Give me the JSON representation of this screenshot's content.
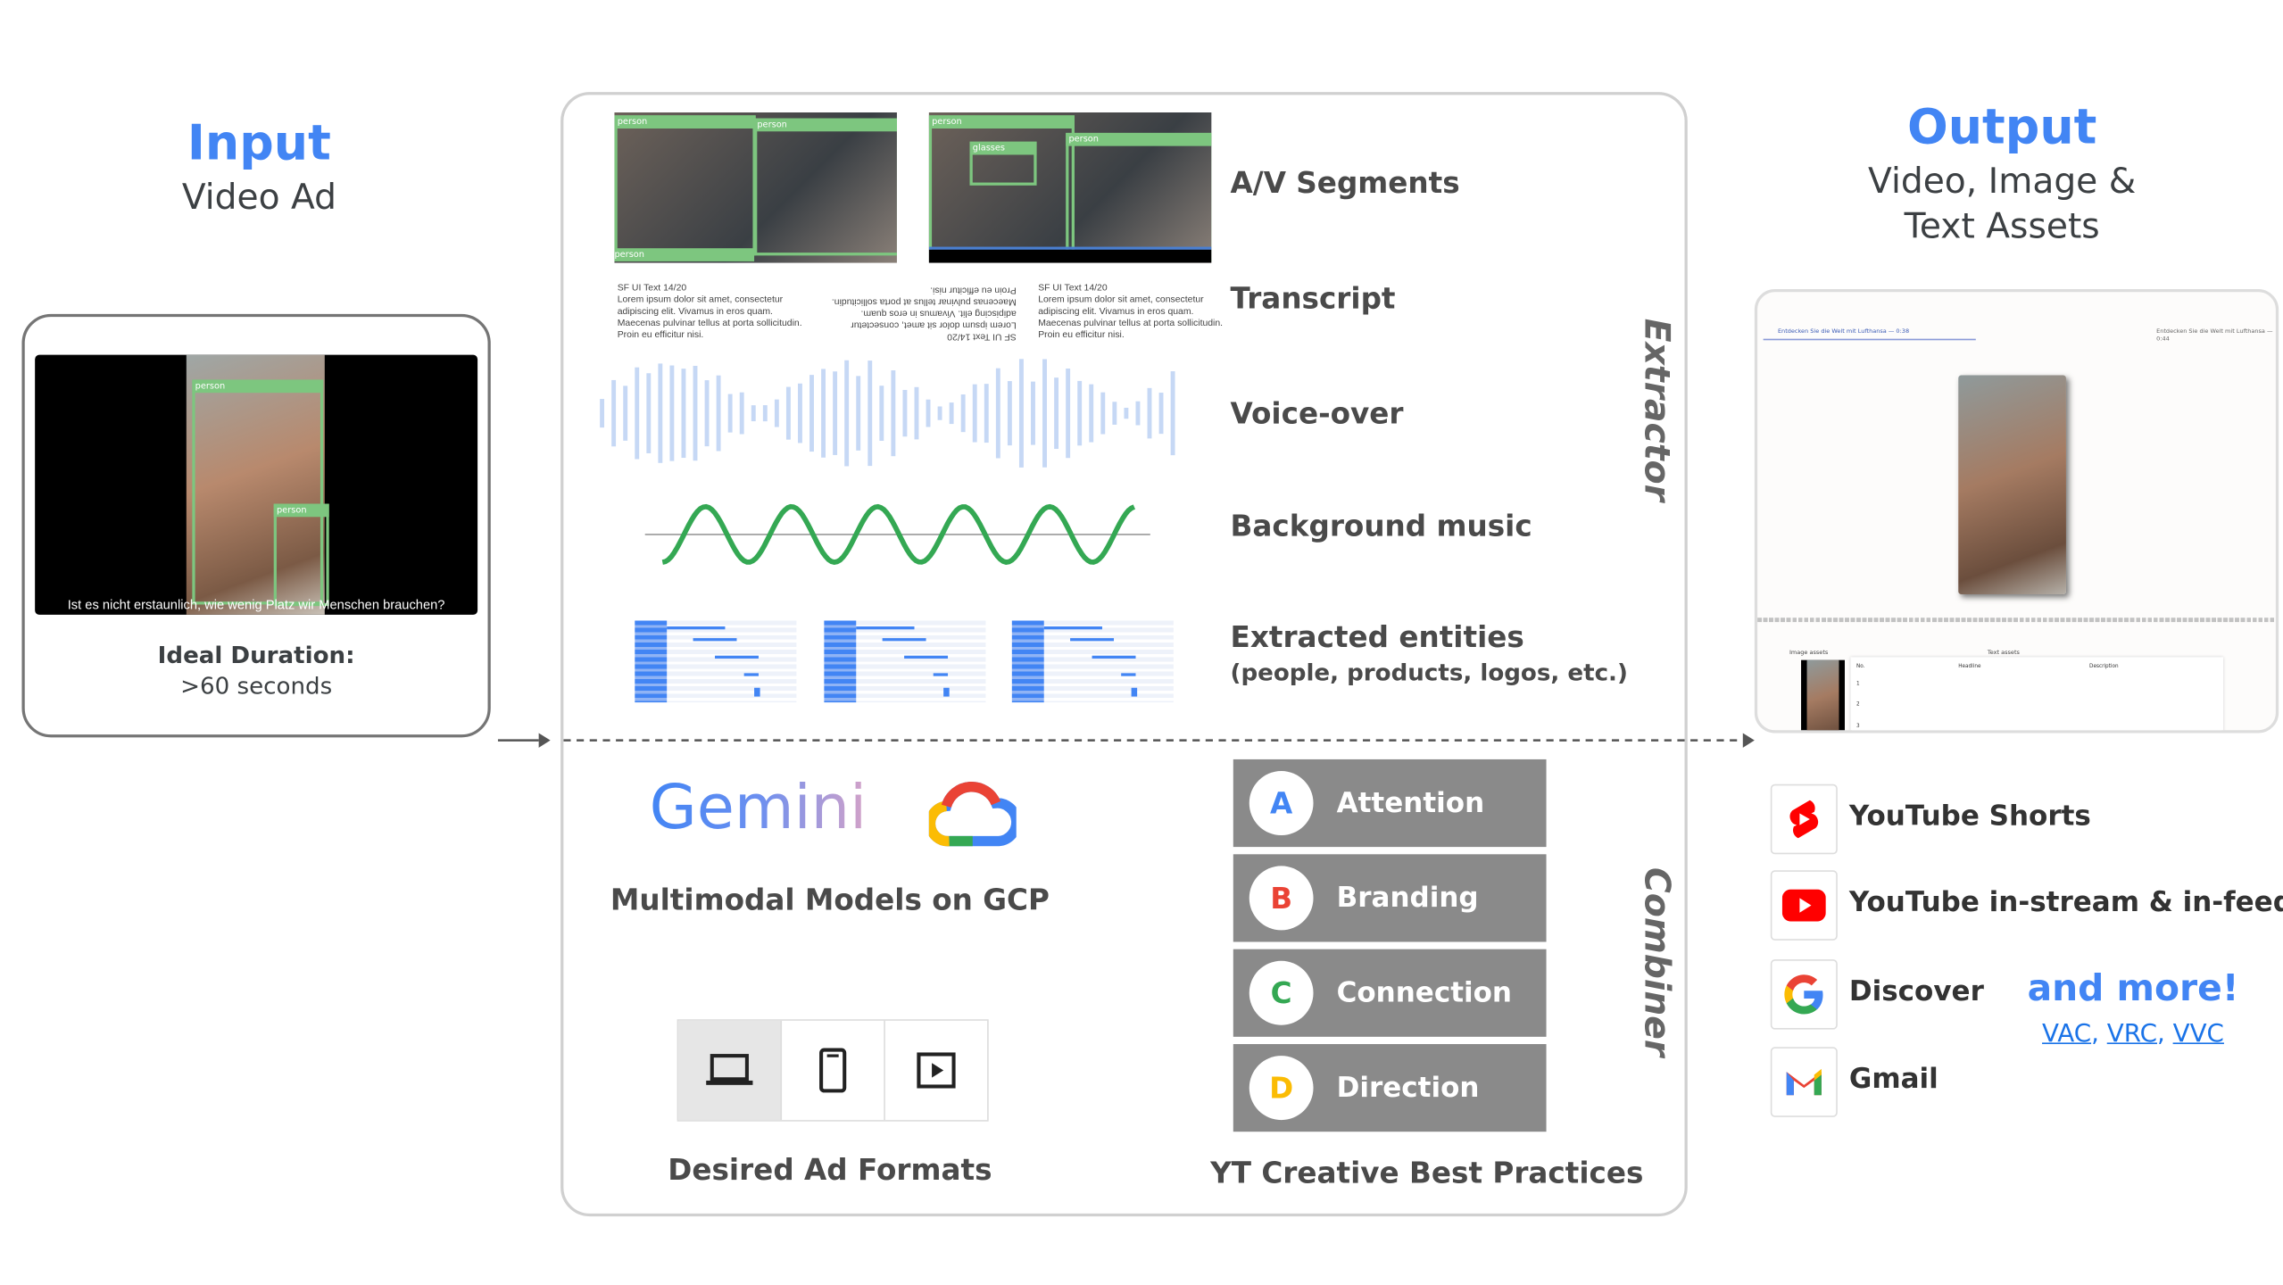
{
  "input": {
    "title": "Input",
    "subtitle": "Video Ad",
    "caption": "Ist es nicht erstaunlich, wie wenig Platz wir Menschen brauchen?",
    "box_label": "person",
    "duration_label": "Ideal Duration:",
    "duration_value": ">60 seconds"
  },
  "extractor": {
    "section_label": "Extractor",
    "segments": {
      "label": "A/V Segments",
      "boxes": [
        "person",
        "person",
        "person",
        "person",
        "glasses",
        "person"
      ]
    },
    "transcript": {
      "label": "Transcript",
      "heading": "SF UI Text 14/20",
      "lines": [
        "Lorem ipsum dolor sit amet, consectetur",
        "adipiscing elit. Vivamus in eros quam.",
        "Maecenas pulvinar tellus at porta sollicitudin.",
        "Proin eu efficitur nisi."
      ]
    },
    "voiceover": {
      "label": "Voice-over"
    },
    "music": {
      "label": "Background music"
    },
    "entities": {
      "label": "Extracted entities",
      "sublabel": "(people, products, logos, etc.)"
    }
  },
  "combiner": {
    "section_label": "Combiner",
    "models": {
      "logo_text": "Gemini",
      "label": "Multimodal Models on GCP"
    },
    "formats": {
      "label": "Desired Ad Formats",
      "options": [
        "laptop-icon",
        "phone-icon",
        "play-icon"
      ],
      "selected": "laptop-icon"
    },
    "practices": {
      "label": "YT Creative Best Practices",
      "items": [
        {
          "letter": "A",
          "label": "Attention",
          "color": "#4285f4"
        },
        {
          "letter": "B",
          "label": "Branding",
          "color": "#ea4335"
        },
        {
          "letter": "C",
          "label": "Connection",
          "color": "#34a853"
        },
        {
          "letter": "D",
          "label": "Direction",
          "color": "#fbbc04"
        }
      ]
    }
  },
  "output": {
    "title": "Output",
    "subtitle_line1": "Video, Image &",
    "subtitle_line2": "Text Assets",
    "preview": {
      "tab_left": "Entdecken Sie die Welt mit Lufthansa — 0:38",
      "tab_right": "Entdecken Sie die Welt mit Lufthansa — 0:44",
      "image_assets": "Image assets",
      "text_assets": "Text assets",
      "columns": [
        "No.",
        "Headline",
        "Description"
      ],
      "rows": [
        "1",
        "2",
        "3"
      ]
    },
    "channels": [
      {
        "icon": "youtube-shorts-icon",
        "label": "YouTube Shorts"
      },
      {
        "icon": "youtube-icon",
        "label": "YouTube in-stream & in-feed"
      },
      {
        "icon": "google-icon",
        "label": "Discover"
      },
      {
        "icon": "gmail-icon",
        "label": "Gmail"
      }
    ],
    "more": {
      "label": "and more!",
      "links": [
        "VAC",
        "VRC",
        "VVC"
      ]
    }
  },
  "colors": {
    "accent": "#4285f4",
    "box_green": "#7dc67f",
    "music_green": "#34a853",
    "wave_blue": "#c6d8f5"
  }
}
